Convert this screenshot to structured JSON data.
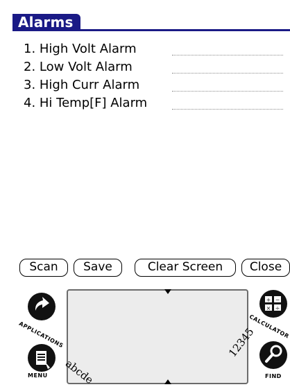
{
  "window": {
    "title": "Alarms"
  },
  "alarms": [
    {
      "label": "1. High Volt Alarm"
    },
    {
      "label": "2. Low Volt Alarm"
    },
    {
      "label": "3. High Curr Alarm"
    },
    {
      "label": "4. Hi Temp[F] Alarm"
    }
  ],
  "buttons": {
    "scan": "Scan",
    "save": "Save",
    "clear": "Clear Screen",
    "close": "Close"
  },
  "silkscreen": {
    "applications_label": "APPLICATIONS",
    "menu_label": "MENU",
    "calculator_label": "CALCULATOR",
    "find_label": "FIND",
    "graffiti_letters": "abcde",
    "graffiti_numbers": "12345"
  },
  "icons": {
    "applications": "applications-icon",
    "menu": "menu-icon",
    "calculator": "calculator-icon",
    "find": "find-icon"
  }
}
